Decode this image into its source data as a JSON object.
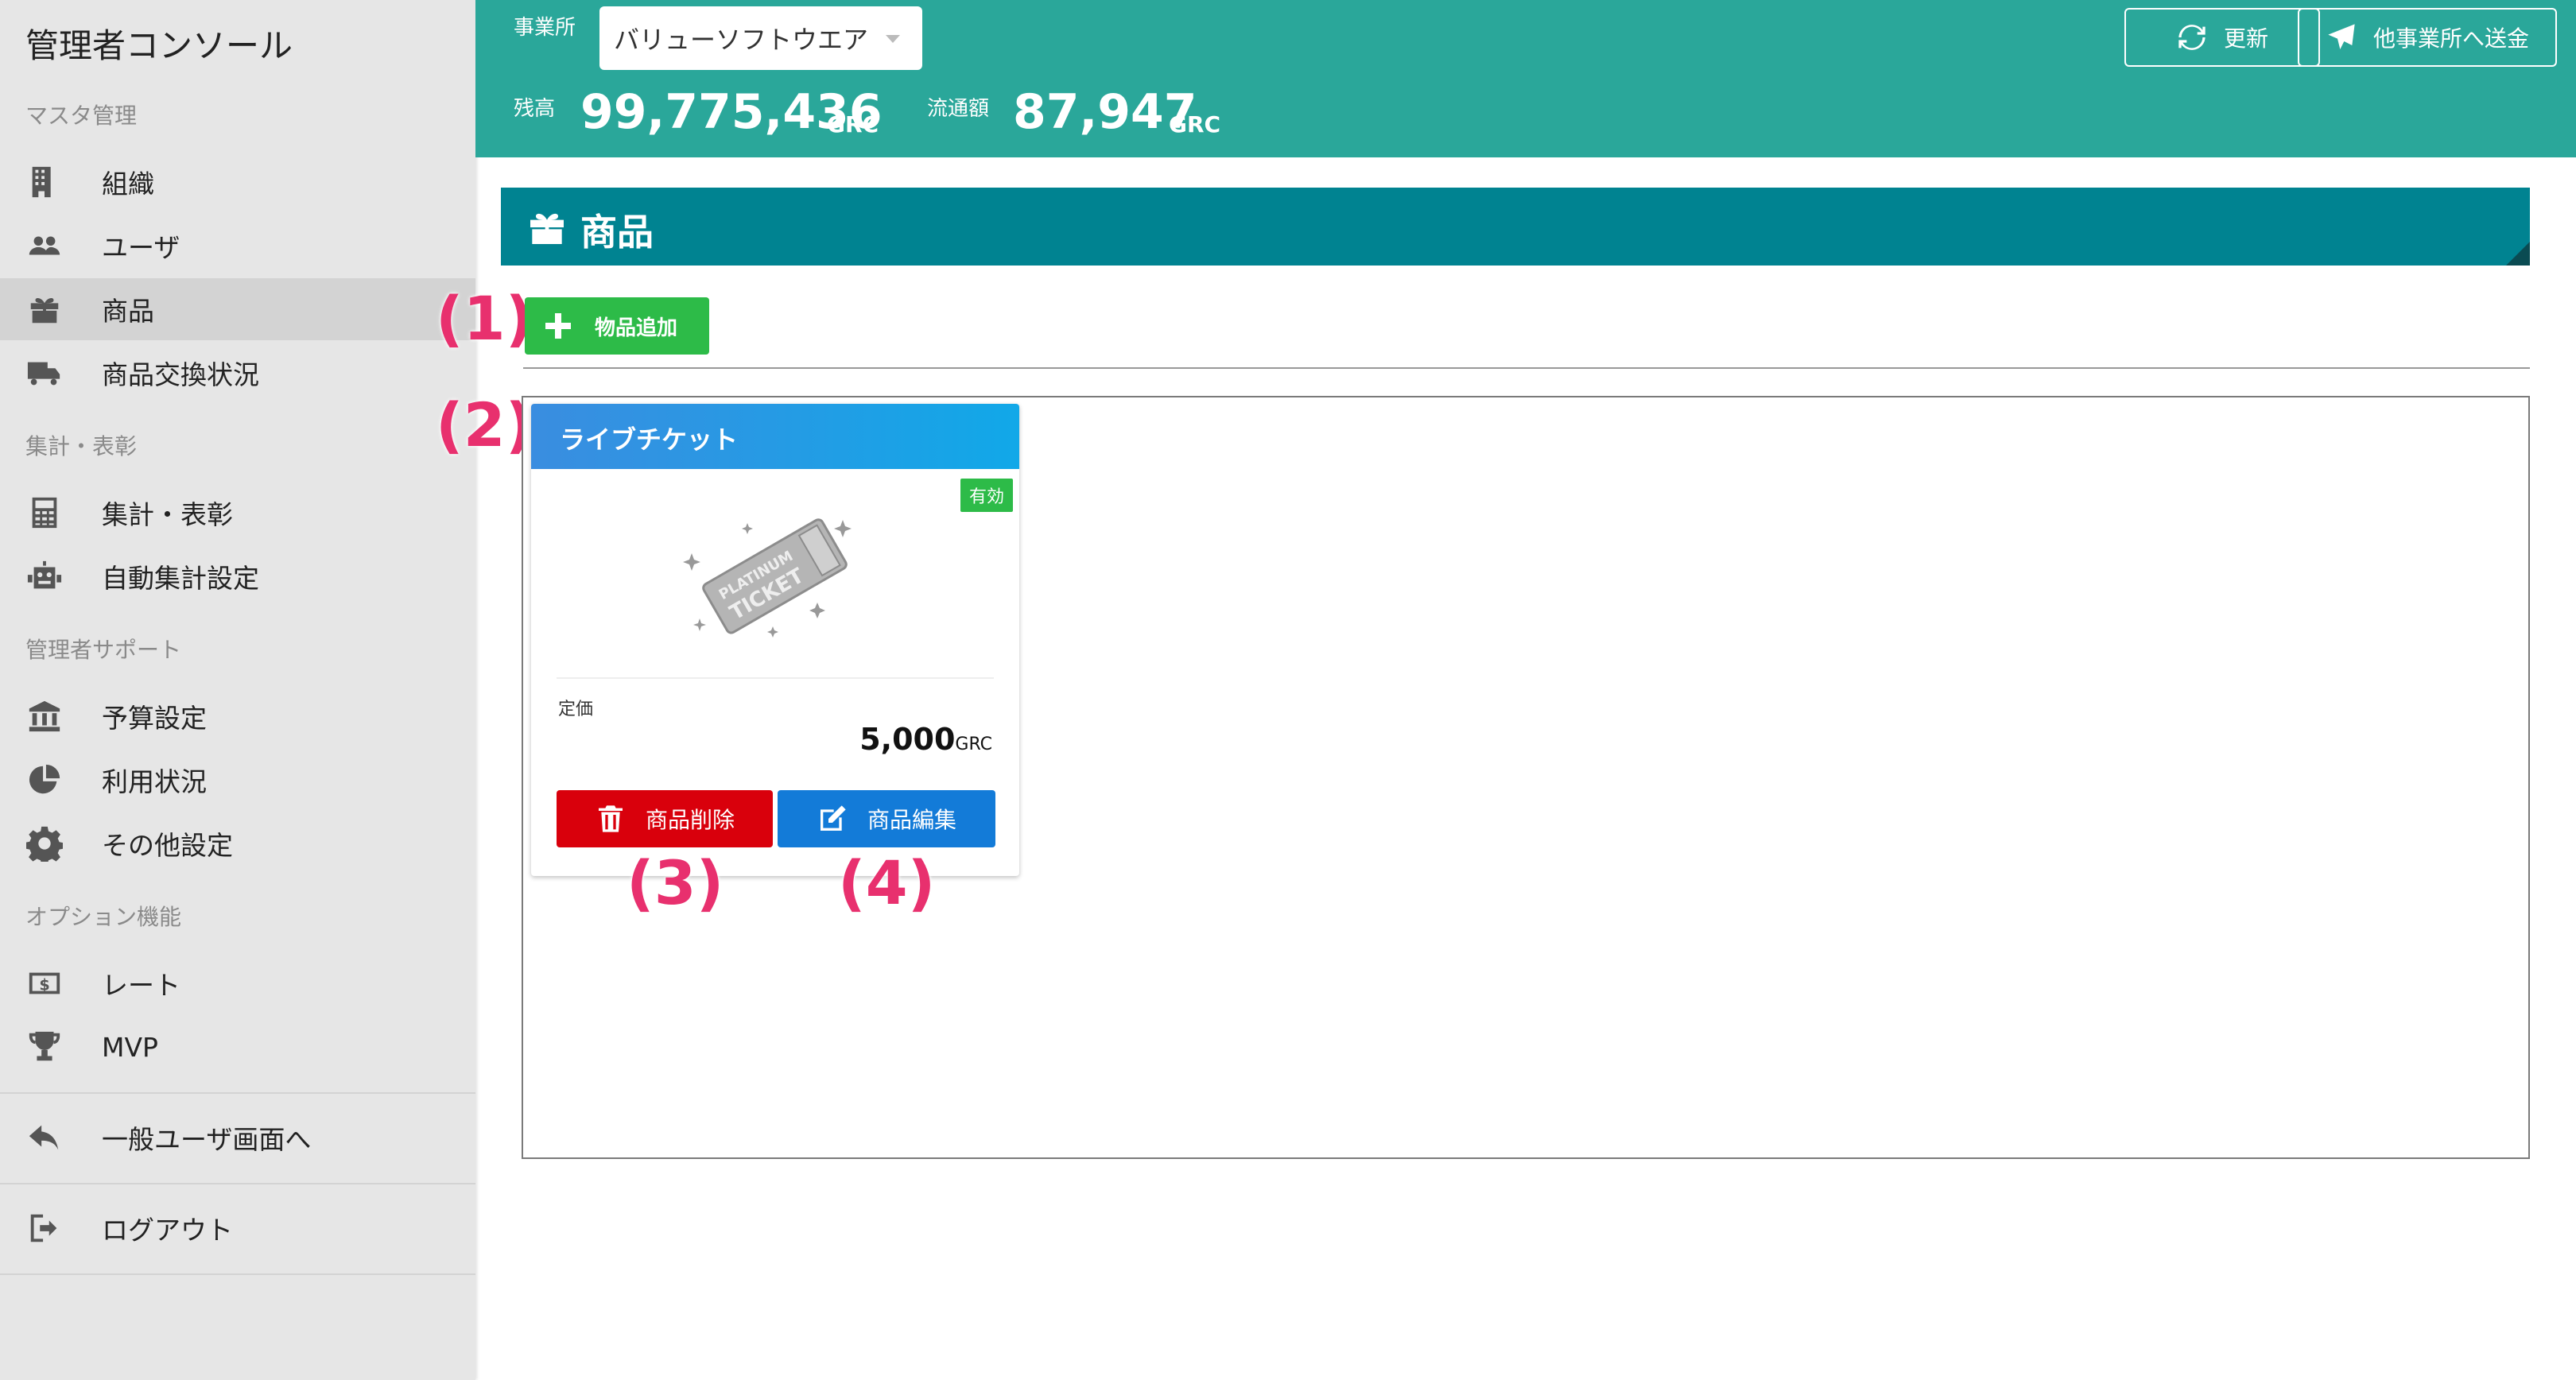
{
  "sidebar": {
    "title": "管理者コンソール",
    "sections": [
      {
        "label": "マスタ管理"
      },
      {
        "label": "集計・表彰"
      },
      {
        "label": "管理者サポート"
      },
      {
        "label": "オプション機能"
      }
    ],
    "items": [
      {
        "label": "組織",
        "icon": "building-icon"
      },
      {
        "label": "ユーザ",
        "icon": "users-icon"
      },
      {
        "label": "商品",
        "icon": "gift-icon",
        "active": true
      },
      {
        "label": "商品交換状況",
        "icon": "truck-icon"
      },
      {
        "label": "集計・表彰",
        "icon": "calculator-icon"
      },
      {
        "label": "自動集計設定",
        "icon": "robot-icon"
      },
      {
        "label": "予算設定",
        "icon": "bank-icon"
      },
      {
        "label": "利用状況",
        "icon": "pie-chart-icon"
      },
      {
        "label": "その他設定",
        "icon": "gear-icon"
      },
      {
        "label": "レート",
        "icon": "dollar-icon"
      },
      {
        "label": "MVP",
        "icon": "trophy-icon"
      },
      {
        "label": "一般ユーザ画面へ",
        "icon": "reply-icon"
      },
      {
        "label": "ログアウト",
        "icon": "logout-icon"
      }
    ]
  },
  "header": {
    "office_label": "事業所",
    "office_value": "バリューソフトウエア",
    "balance_label": "残高",
    "balance_value": "99,775,436",
    "balance_unit": "GRC",
    "circulation_label": "流通額",
    "circulation_value": "87,947",
    "circulation_unit": "GRC",
    "refresh_label": "更新",
    "send_label": "他事業所へ送金"
  },
  "main": {
    "section_title": "商品",
    "add_button_label": "物品追加",
    "products": [
      {
        "name": "ライブチケット",
        "status": "有効",
        "image_text_1": "PLATINUM",
        "image_text_2": "TICKET",
        "price_label": "定価",
        "price_value": "5,000",
        "price_unit": "GRC",
        "delete_label": "商品削除",
        "edit_label": "商品編集"
      }
    ]
  },
  "annotations": [
    "(1)",
    "(2)",
    "(3)",
    "(4)"
  ],
  "colors": {
    "header_bg": "#2aa79a",
    "section_bar": "#008391",
    "add_button": "#2dbb48",
    "delete_button": "#d9000c",
    "edit_button": "#137bd8",
    "annotation": "#e8306e"
  }
}
